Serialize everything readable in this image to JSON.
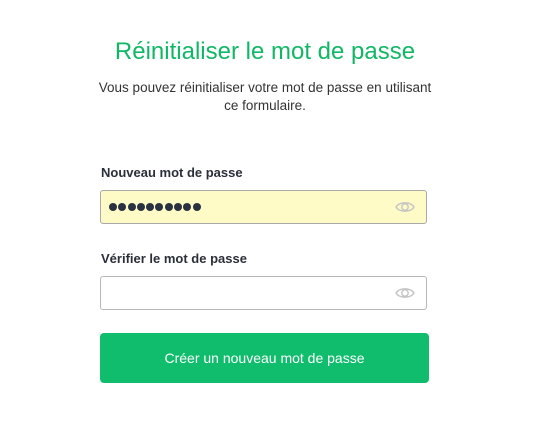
{
  "page": {
    "title": "Réinitialiser le mot de passe",
    "subtitle_line1": "Vous pouvez réinitialiser votre mot de passe en utilisant",
    "subtitle_line2": "ce formulaire."
  },
  "form": {
    "new_password": {
      "label": "Nouveau mot de passe",
      "masked_length": 10
    },
    "verify_password": {
      "label": "Vérifier le mot de passe",
      "value": ""
    },
    "submit_label": "Créer un nouveau mot de passe"
  },
  "icons": {
    "toggle_visibility": "eye-icon"
  },
  "colors": {
    "accent": "#10b866",
    "autofill": "#fefbc6"
  }
}
